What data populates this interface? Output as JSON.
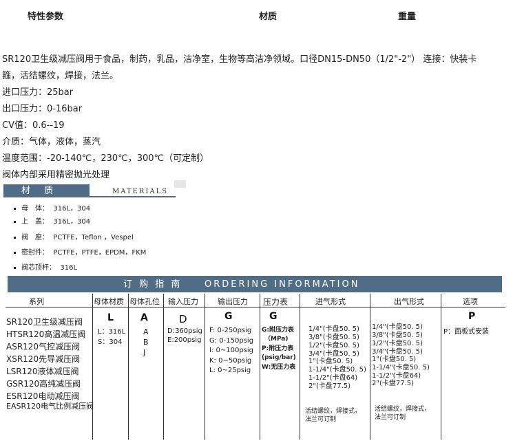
{
  "header": {
    "col1": "特性参数",
    "col2": "材质",
    "col3": "重量"
  },
  "description": {
    "line1": "SR120卫生级减压阀用于食品，制药，乳品，洁净室，生物等高洁净领域。口径DN15-DN50（1/2\"-2\"） 连接：快装卡",
    "line2": "箍，活结螺纹，焊接，法兰。",
    "line3": "进口压力：25bar",
    "line4": "出口压力：0-16bar",
    "line5": "CV值：0.6--19",
    "line6": "介质：气体，液体，蒸汽",
    "line7": "温度范围：-20-140℃，230℃，300℃（可定制）",
    "line8": "阀体内部采用精密抛光处理"
  },
  "materials": {
    "title_cn": "材  质",
    "title_en": "MATERIALS",
    "items": [
      {
        "label": "母　体：",
        "value": "316L，304"
      },
      {
        "label": "上　盖：",
        "value": "316L，304"
      },
      {
        "label": "阀　座：",
        "value": "PCTFE，Teflon ，Vespel"
      },
      {
        "label": "密封件：",
        "value": "PCTFE，PTFE，EPDM，FKM"
      },
      {
        "label": "阀芯顶杆：",
        "value": "316L"
      }
    ]
  },
  "ordering": {
    "title_cn": "订 购 指 南",
    "title_en": "ORDERING  INFORMATION",
    "headers": [
      "系列",
      "母体材质",
      "母体孔位",
      "输入压力",
      "输出压力",
      "压力表",
      "进气形式",
      "出气形式",
      "选项"
    ],
    "series": [
      "SR120卫生级减压阀",
      "HTSR120高温减压阀",
      "ASR120气控减压阀",
      "XSR120先导减压阀",
      "LSR120液体减压阀",
      "GSR120高纯减压阀",
      "ESR120电动减压阀",
      "EASR120电气比例减压阀"
    ],
    "body_material": {
      "code": "L",
      "lines": [
        "L：316L",
        "S：304"
      ]
    },
    "body_port": {
      "code": "A",
      "lines": [
        "A",
        "B",
        "J"
      ]
    },
    "input_pressure": {
      "code": "D",
      "lines": [
        "D:360psig",
        "E:200psig"
      ]
    },
    "output_pressure": {
      "code": "G",
      "lines": [
        "F:  0-250psig",
        "G:  0-150psig",
        "I:   0~100psig",
        "K:  0~50psig",
        "L:   0~25psig"
      ]
    },
    "gauge": {
      "code": "G",
      "lines": [
        "G:附压力表",
        "（MPa)",
        "P:附压力表",
        "(psig/bar)",
        "W:无压力表"
      ]
    },
    "inlet": {
      "lines": [
        "1/4\"(卡盘50. 5)",
        "3/8\"(卡盘50. 5)",
        "1/2\"(卡盘50. 5)",
        "3/4\"(卡盘50. 5)",
        "1\"(卡盘50. 5)",
        "1-1/4\"(卡盘50. 5)",
        "1-1/2\"(卡盘64)",
        "2\"(卡盘77.5)"
      ],
      "note1": "活结螺纹，焊接式，",
      "note2": "法兰可订制"
    },
    "outlet": {
      "lines": [
        "1/4\"(卡盘50. 5)",
        "3/8\"(卡盘50. 5)",
        "1/2\"(卡盘50. 5)",
        "3/4\"(卡盘50. 5)",
        "1\"(卡盘50. 5)",
        "1-1/4\"(卡盘50. 5)",
        "1-1/2\"(卡盘64)",
        "2\"(卡盘77.5)"
      ],
      "note1": "活结螺纹，焊接式，",
      "note2": "法兰可订制"
    },
    "option": {
      "code": "P",
      "lines": [
        "P：面板式安装"
      ]
    }
  }
}
